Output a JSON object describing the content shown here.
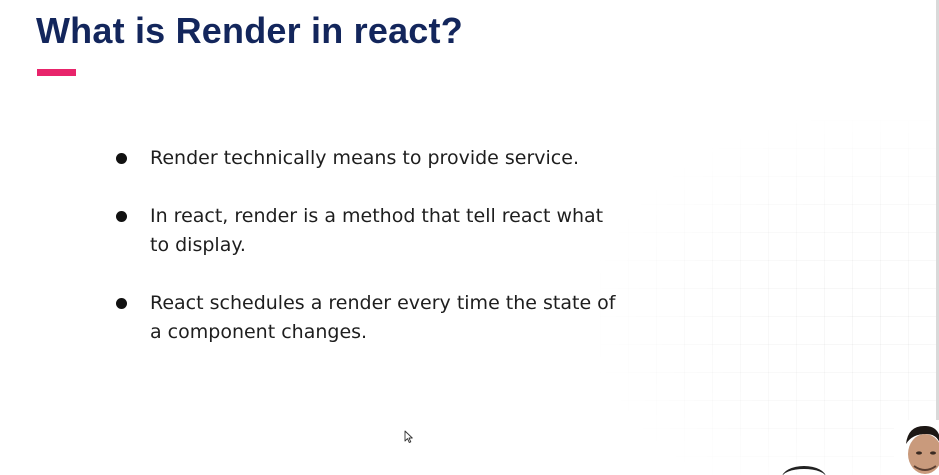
{
  "slide": {
    "title": "What is Render in react?",
    "colors": {
      "title": "#13265c",
      "accent": "#e8246b",
      "text": "#1e1e1e",
      "background": "#ffffff"
    },
    "bullets": [
      {
        "lines": [
          "Render technically means to provide service."
        ]
      },
      {
        "lines": [
          "In react, render is a method that tell react what",
          "to display."
        ]
      },
      {
        "lines": [
          "React schedules a render every time the state of",
          "a component changes."
        ]
      }
    ]
  },
  "overlay": {
    "cursor_icon": "mouse-pointer-icon",
    "webcam": "presenter-webcam"
  }
}
